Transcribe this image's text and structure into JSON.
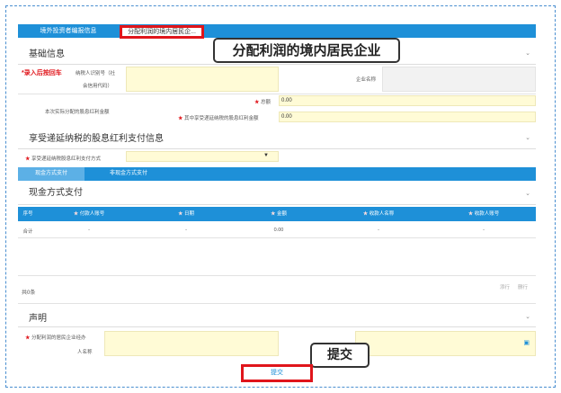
{
  "tabs": {
    "tab1": "境外投资者编报信息",
    "tab2": "分配利润的境内居民企..."
  },
  "callout_top": "分配利润的境内居民企业",
  "basic": {
    "title": "基础信息",
    "entry_hint": "*录入后按回车",
    "taxid_label_1": "纳税人识别号（社",
    "taxid_label_2": "会信用代码）",
    "company_label": "企业名称",
    "dividend_label": "本次实际分配的股息红利金额",
    "total_label": "总额",
    "total_value": "0.00",
    "deferred_label": "其中享受递延纳税的股息红利金额",
    "deferred_value": "0.00"
  },
  "deferred_section": {
    "title": "享受递延纳税的股息红利支付信息",
    "pay_method_label": "享受递延纳税股息红利支付方式"
  },
  "subtabs": {
    "cash": "现金方式支付",
    "noncash": "非现金方式支付"
  },
  "cash_section": {
    "title": "现金方式支付",
    "columns": [
      "序号",
      "付款人账号",
      "日期",
      "金额",
      "收款人名称",
      "收款人账号"
    ],
    "total_row": [
      "合计",
      "-",
      "-",
      "0.00",
      "-",
      "-"
    ],
    "count": "共0条",
    "add_label": "添行",
    "delete_label": "删行"
  },
  "declaration": {
    "title": "声明",
    "label_1": "分配利润的居民企业经办",
    "label_2": "人名称"
  },
  "callout_bottom": "提交",
  "submit_label": "提交",
  "colors": {
    "accent": "#1e90d8",
    "highlight": "#e0151b",
    "input_bg": "#fffbd6"
  }
}
